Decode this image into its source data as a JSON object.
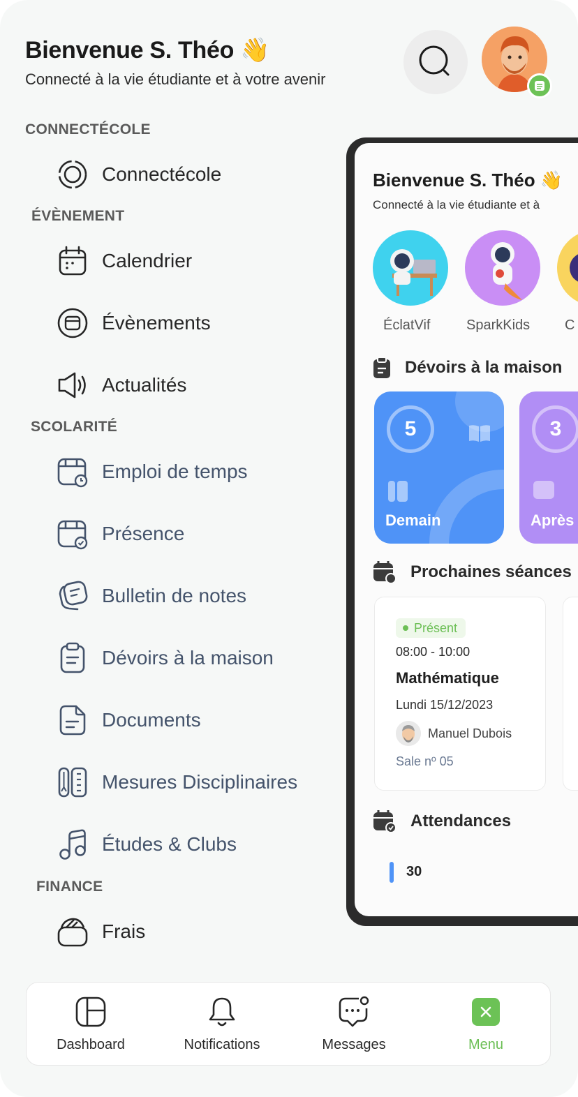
{
  "header": {
    "title": "Bienvenue S. Théo",
    "wave_emoji": "👋",
    "subtitle": "Connecté à la vie étudiante et à votre avenir"
  },
  "menu": {
    "sections": [
      {
        "title": "CONNECTÉCOLE",
        "items": [
          {
            "label": "Connectécole",
            "icon": "connectecole-icon"
          }
        ]
      },
      {
        "title": "ÉVÈNEMENT",
        "items": [
          {
            "label": "Calendrier",
            "icon": "calendar-icon"
          },
          {
            "label": "Évènements",
            "icon": "events-icon"
          },
          {
            "label": "Actualités",
            "icon": "megaphone-icon"
          }
        ]
      },
      {
        "title": "SCOLARITÉ",
        "items": [
          {
            "label": "Emploi de temps",
            "icon": "timetable-icon"
          },
          {
            "label": "Présence",
            "icon": "attendance-icon"
          },
          {
            "label": "Bulletin de notes",
            "icon": "report-card-icon"
          },
          {
            "label": "Dévoirs à la maison",
            "icon": "clipboard-icon"
          },
          {
            "label": "Documents",
            "icon": "document-icon"
          },
          {
            "label": "Mesures Disciplinaires",
            "icon": "ruler-icon"
          },
          {
            "label": "Études & Clubs",
            "icon": "music-note-icon"
          }
        ]
      },
      {
        "title": "FINANCE",
        "items": [
          {
            "label": "Frais",
            "icon": "wallet-icon"
          }
        ]
      }
    ]
  },
  "preview": {
    "title": "Bienvenue S. Théo 👋",
    "subtitle": "Connecté à la vie étudiante et à",
    "clubs": [
      {
        "name": "ÉclatVif"
      },
      {
        "name": "SparkKids"
      },
      {
        "name": "C"
      }
    ],
    "homework_title": "Dévoirs à la maison",
    "homework": [
      {
        "count": "5",
        "label": "Demain",
        "color": "#4f93f7"
      },
      {
        "count": "3",
        "label": "Après",
        "color": "#b18ef5"
      }
    ],
    "sessions_title": "Prochaines séances",
    "session": {
      "status": "Présent",
      "time": "08:00 - 10:00",
      "subject": "Mathématique",
      "date": "Lundi 15/12/2023",
      "teacher": "Manuel Dubois",
      "room": "Sale nº 05"
    },
    "attendance_title": "Attendances",
    "attendance_value": "30"
  },
  "nav": {
    "items": [
      {
        "label": "Dashboard",
        "icon": "dashboard-icon"
      },
      {
        "label": "Notifications",
        "icon": "bell-icon"
      },
      {
        "label": "Messages",
        "icon": "chat-icon"
      },
      {
        "label": "Menu",
        "icon": "close-icon",
        "active": true
      }
    ]
  },
  "colors": {
    "accent_green": "#6cc256",
    "blue": "#4f93f7",
    "purple": "#b18ef5",
    "slate_text": "#44536b"
  }
}
